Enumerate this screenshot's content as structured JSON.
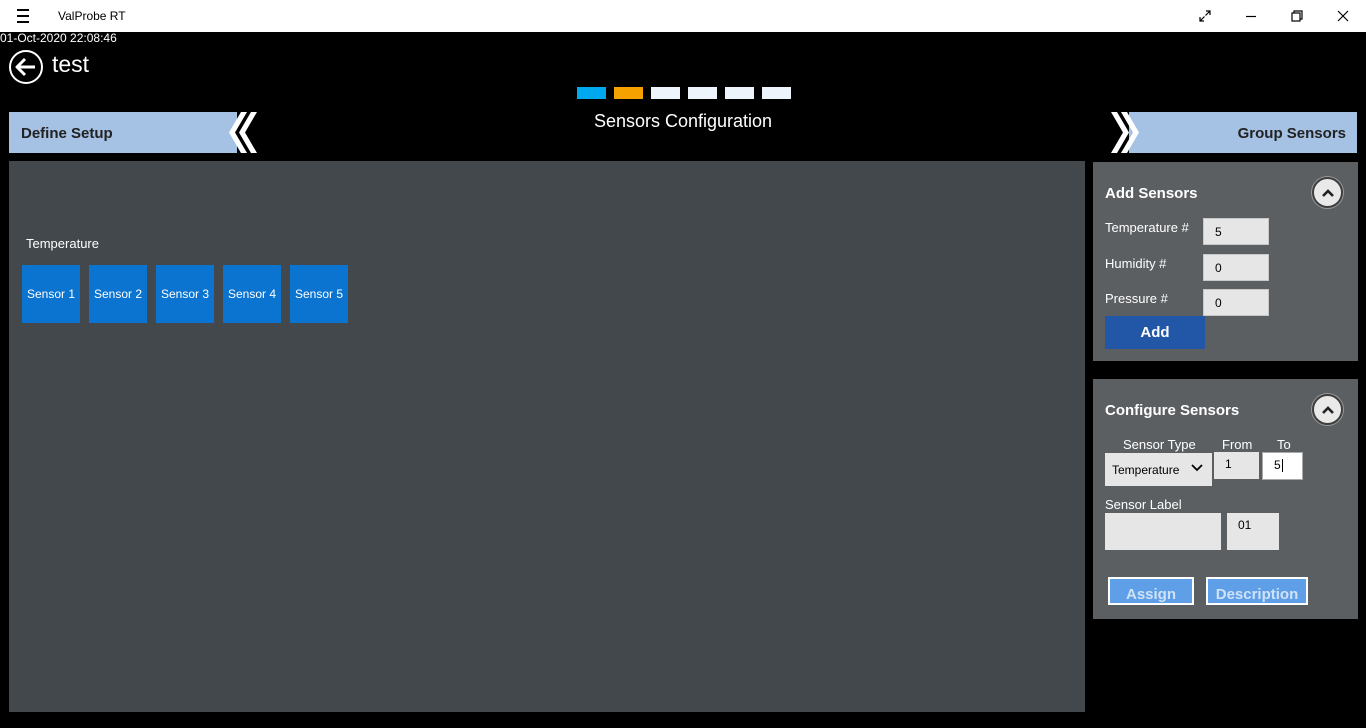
{
  "window": {
    "app_title": "ValProbe RT",
    "controls": [
      "expand-icon",
      "minimize-icon",
      "restore-icon",
      "close-icon"
    ]
  },
  "header": {
    "timestamp": "01-Oct-2020 22:08:46",
    "page_title": "test",
    "section_title": "Sensors Configuration",
    "steps": [
      {
        "state": "done",
        "color": "#00a8f0"
      },
      {
        "state": "current",
        "color": "#f5a100"
      },
      {
        "state": "pending",
        "color": "#eef4fb"
      },
      {
        "state": "pending",
        "color": "#eef4fb"
      },
      {
        "state": "pending",
        "color": "#eef4fb"
      },
      {
        "state": "pending",
        "color": "#eef4fb"
      }
    ],
    "prev_nav_label": "Define Setup",
    "next_nav_label": "Group Sensors"
  },
  "canvas": {
    "group_label": "Temperature",
    "sensors": [
      "Sensor 1",
      "Sensor 2",
      "Sensor 3",
      "Sensor 4",
      "Sensor 5"
    ]
  },
  "add_sensors": {
    "title": "Add Sensors",
    "temperature_label": "Temperature #",
    "temperature_value": "5",
    "humidity_label": "Humidity #",
    "humidity_value": "0",
    "pressure_label": "Pressure #",
    "pressure_value": "0",
    "add_label": "Add"
  },
  "configure_sensors": {
    "title": "Configure Sensors",
    "sensor_type_label": "Sensor Type",
    "sensor_type_value": "Temperature",
    "from_label": "From",
    "from_value": "1",
    "to_label": "To",
    "to_value": "5",
    "sensor_label_label": "Sensor Label",
    "sensor_label_value": "",
    "label_number_value": "01",
    "assign_label": "Assign",
    "description_label": "Description"
  },
  "colors": {
    "accent_blue": "#0a74d0",
    "nav_bar": "#a5c1e3",
    "canvas_bg": "#43484c",
    "panel_bg": "#5b5f62",
    "add_button": "#2257a8"
  }
}
